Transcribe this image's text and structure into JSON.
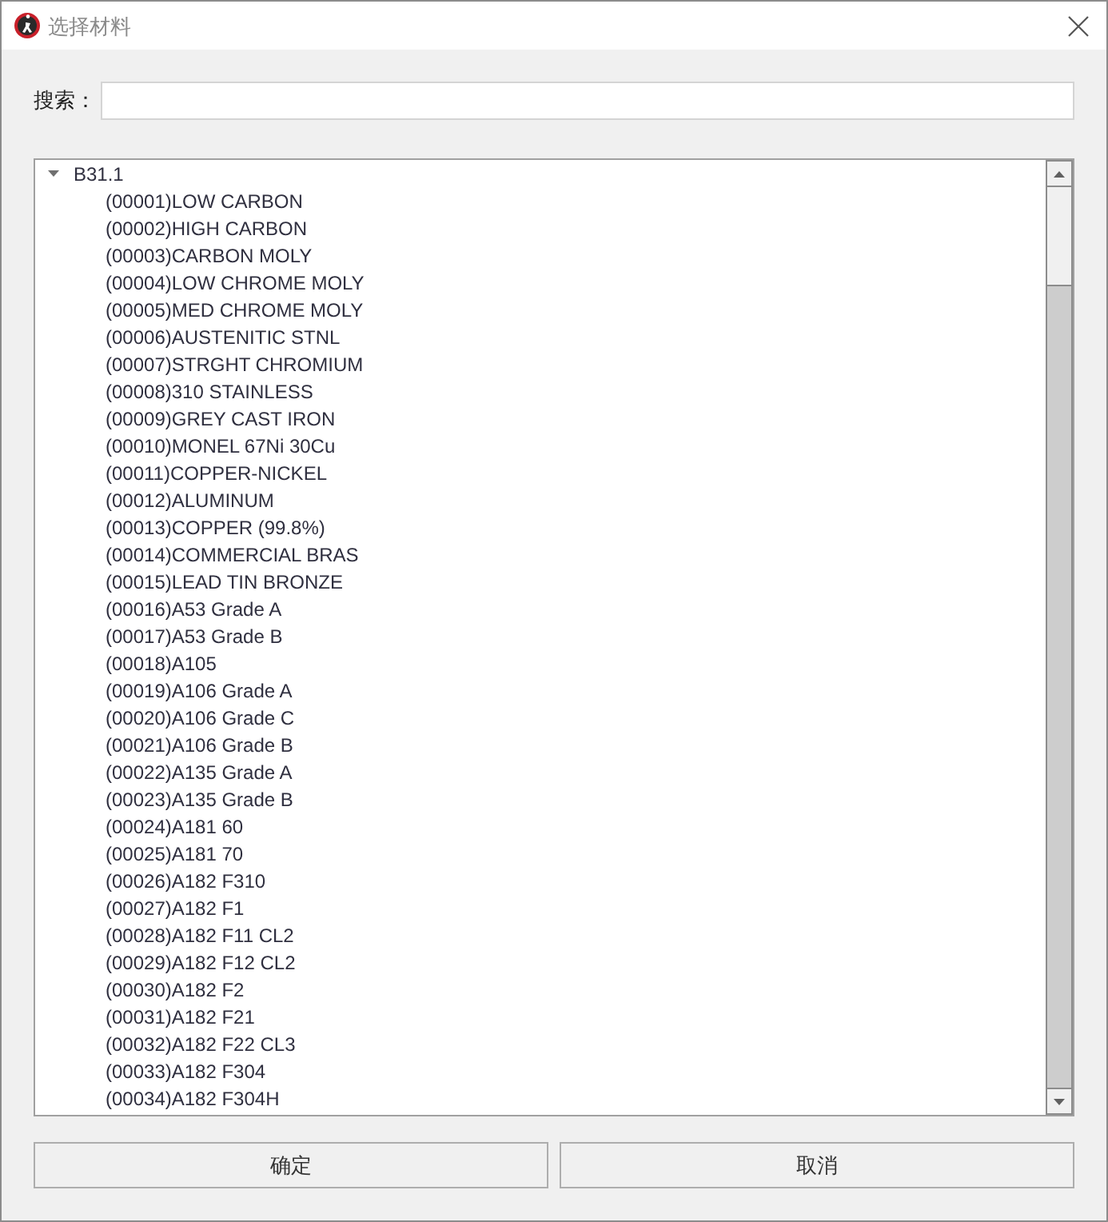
{
  "window": {
    "title": "选择材料"
  },
  "search": {
    "label": "搜索："
  },
  "tree": {
    "items": [
      {
        "label": "B31.1",
        "expanded": true,
        "children": [
          {
            "label": "(00001)LOW CARBON"
          },
          {
            "label": "(00002)HIGH CARBON"
          },
          {
            "label": "(00003)CARBON MOLY"
          },
          {
            "label": "(00004)LOW CHROME MOLY"
          },
          {
            "label": "(00005)MED CHROME MOLY"
          },
          {
            "label": "(00006)AUSTENITIC STNL"
          },
          {
            "label": "(00007)STRGHT CHROMIUM"
          },
          {
            "label": "(00008)310 STAINLESS"
          },
          {
            "label": "(00009)GREY CAST IRON"
          },
          {
            "label": "(00010)MONEL 67Ni 30Cu"
          },
          {
            "label": "(00011)COPPER-NICKEL"
          },
          {
            "label": "(00012)ALUMINUM"
          },
          {
            "label": "(00013)COPPER (99.8%)"
          },
          {
            "label": "(00014)COMMERCIAL BRAS"
          },
          {
            "label": "(00015)LEAD TIN BRONZE"
          },
          {
            "label": "(00016)A53 Grade A"
          },
          {
            "label": "(00017)A53 Grade B"
          },
          {
            "label": "(00018)A105"
          },
          {
            "label": "(00019)A106 Grade A"
          },
          {
            "label": "(00020)A106 Grade C"
          },
          {
            "label": "(00021)A106 Grade B"
          },
          {
            "label": "(00022)A135 Grade A"
          },
          {
            "label": "(00023)A135 Grade B"
          },
          {
            "label": "(00024)A181 60"
          },
          {
            "label": "(00025)A181 70"
          },
          {
            "label": "(00026)A182 F310"
          },
          {
            "label": "(00027)A182 F1"
          },
          {
            "label": "(00028)A182 F11 CL2"
          },
          {
            "label": "(00029)A182 F12 CL2"
          },
          {
            "label": "(00030)A182 F2"
          },
          {
            "label": "(00031)A182 F21"
          },
          {
            "label": "(00032)A182 F22 CL3"
          },
          {
            "label": "(00033)A182 F304"
          },
          {
            "label": "(00034)A182 F304H"
          }
        ]
      }
    ]
  },
  "buttons": [
    {
      "label": "确定"
    },
    {
      "label": "取消"
    }
  ]
}
